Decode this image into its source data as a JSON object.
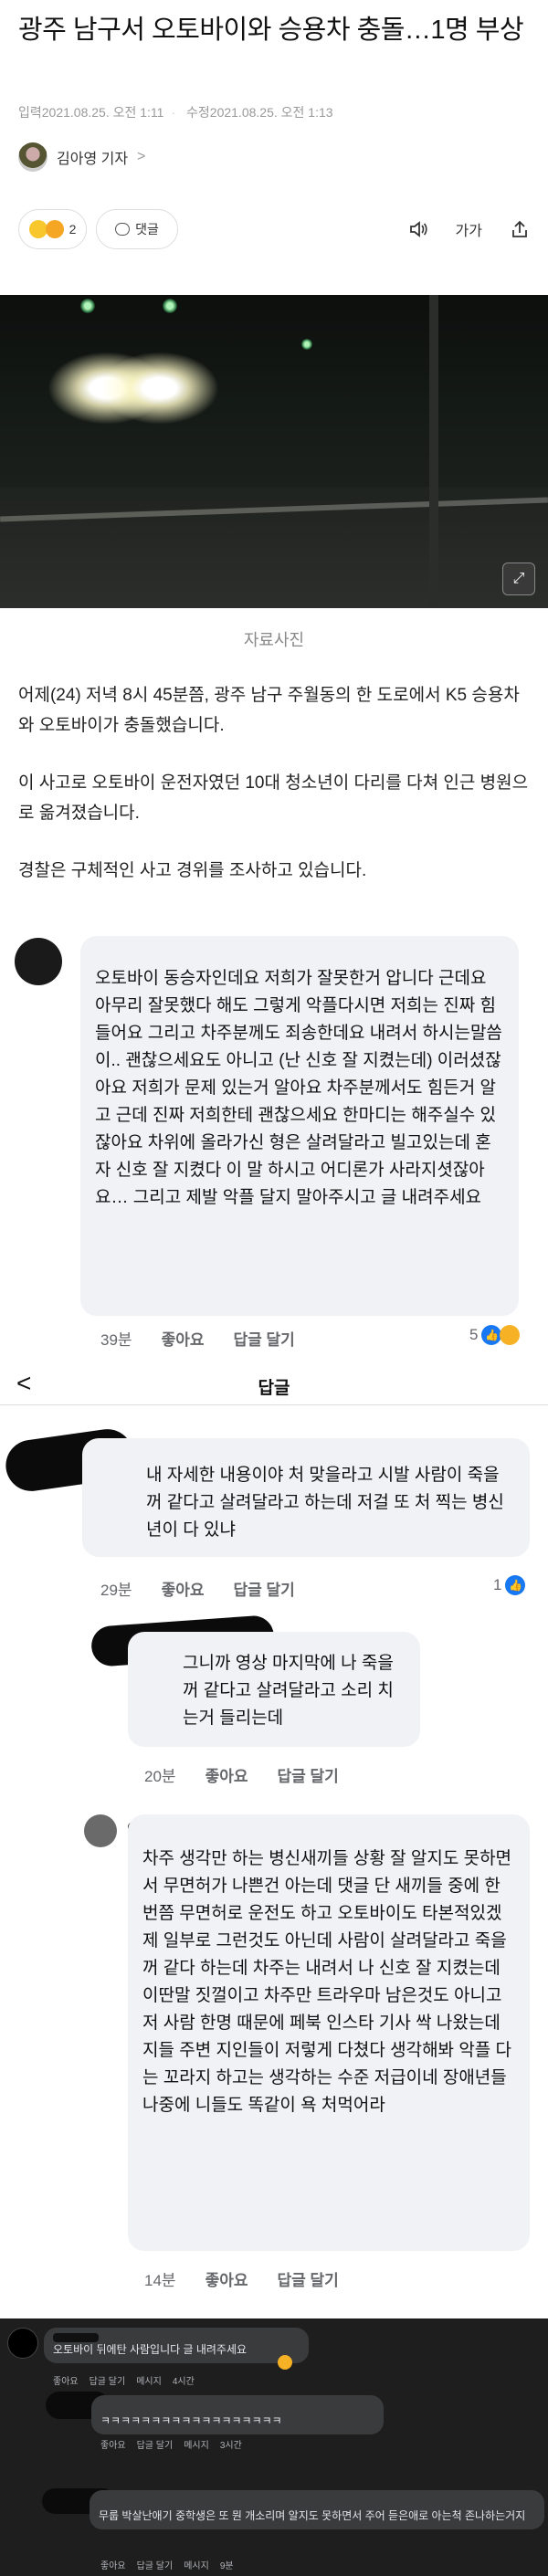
{
  "article": {
    "title": "광주 남구서 오토바이와 승용차 충돌…1명 부상",
    "published": "입력2021.08.25. 오전 1:11",
    "modified": "수정2021.08.25. 오전 1:13",
    "reporter": "김아영 기자",
    "reporter_chevron": ">",
    "reaction_count": "2",
    "comment_label": "댓글",
    "font_label": "가가",
    "image_caption": "자료사진",
    "paragraphs": [
      "어제(24) 저녁 8시 45분쯤, 광주 남구 주월동의 한 도로에서 K5 승용차와 오토바이가 충돌했습니다.",
      "이 사고로 오토바이 운전자였던 10대 청소년이 다리를 다쳐 인근 병원으로 옮겨졌습니다.",
      "경찰은 구체적인 사고 경위를 조사하고 있습니다."
    ]
  },
  "fb": {
    "reply_header": "답글",
    "back": "<",
    "comments": [
      {
        "text": "오토바이 동승자인데요 저희가 잘못한거 압니다 근데요 아무리 잘못했다 해도 그렇게 악플다시면 저희는 진짜 힘들어요 그리고 차주분께도 죄송한데요 내려서 하시는말씀이.. 괜찮으세요도 아니고 (난 신호 잘 지켰는데) 이러셨잖아요 저희가 문제 있는거 알아요 차주분께서도 힘든거 알고 근데 진짜 저희한테 괜찮으세요 한마디는 해주실수 있잖아요 차위에 올라가신 형은 살려달라고 빌고있는데 혼자 신호 잘 지켰다 이 말 하시고 어디론가 사라지셧잖아요… 그리고 제발 악플 달지 말아주시고 글 내려주세요",
        "time": "39분",
        "like": "좋아요",
        "reply": "답글 달기",
        "count": "5"
      },
      {
        "text": "내 자세한 내용이야 처 맞을라고 시발 사람이 죽을꺼 같다고 살려달라고 하는데 저걸 또 처 찍는 병신년이 다 있냐",
        "time": "29분",
        "like": "좋아요",
        "reply": "답글 달기",
        "count": "1"
      },
      {
        "text": "그니까 영상 마지막에 나 죽을꺼 같다고 살려달라고 소리 치는거 들리는데",
        "time": "20분",
        "like": "좋아요",
        "reply": "답글 달기"
      },
      {
        "text": "차주 생각만 하는 병신새끼들 상황 잘 알지도 못하면서 무면허가 나쁜건 아는데 댓글 단 새끼들 중에 한번쯤 무면허로 운전도 하고 오토바이도 타본적있겠제 일부로 그런것도 아닌데 사람이 살려달라고 죽을꺼 같다 하는데 차주는 내려서 나 신호 잘 지켰는데 이딴말 짓껄이고 차주만 트라우마 남은것도 아니고 저 사람 한명 때문에 페북 인스타 기사 싹 나왔는데 지들 주변 지인들이 저렇게 다쳤다 생각해봐 악플 다는 꼬라지 하고는 생각하는 수준 저급이네 장애년들 나중에 니들도 똑같이 욕 처먹어라",
        "time": "14분",
        "like": "좋아요",
        "reply": "답글 달기"
      }
    ]
  },
  "ig": {
    "comments": [
      {
        "text": "오토바이 뒤에탄 사람입니다 글 내려주세요",
        "like": "좋아요",
        "reply": "답글 달기",
        "message": "메시지",
        "time": "4시간"
      },
      {
        "text": "ㅋㅋㅋㅋㅋㅋㅋㅋㅋㅋㅋㅋㅋㅋㅋㅋㅋㅋ",
        "like": "좋아요",
        "reply": "답글 달기",
        "message": "메시지",
        "time": "3시간"
      },
      {
        "text": "무룹 박살난애기 중학생은 또 뭔 개소리며 알지도 못하면서 주어 듣은애로 아는척 존나하는거지",
        "like": "좋아요",
        "reply": "답글 달기",
        "message": "메시지",
        "time": "9분"
      }
    ]
  }
}
